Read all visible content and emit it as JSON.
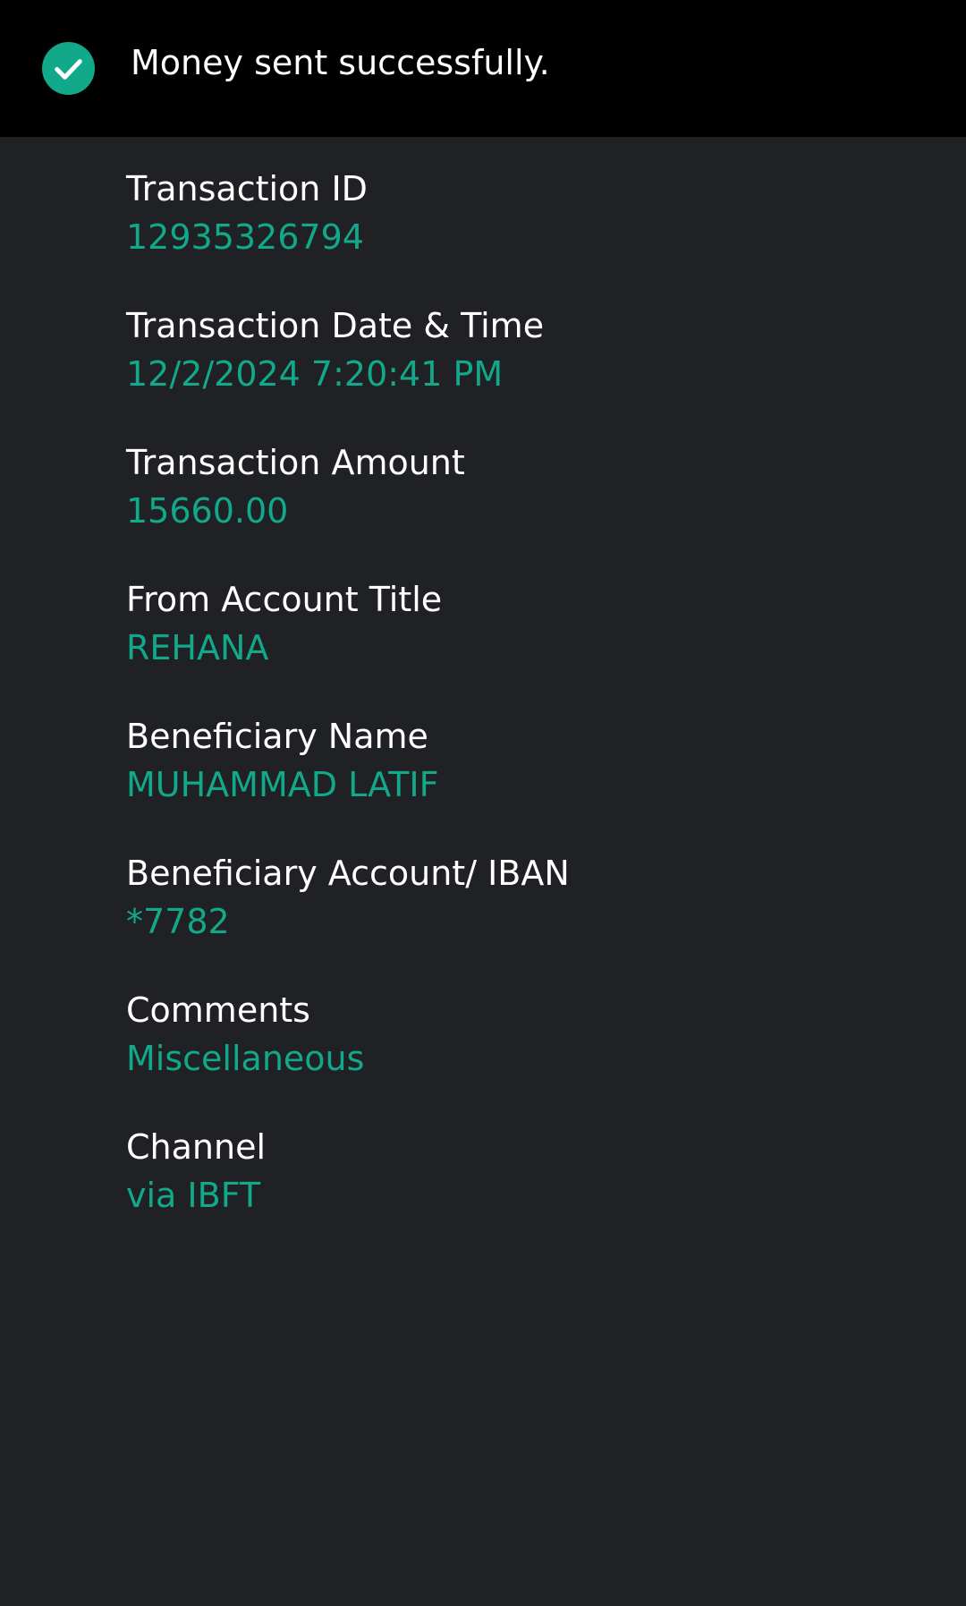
{
  "banner": {
    "message": "Money sent successfully.",
    "icon": "check-circle-icon",
    "accent_color": "#12a88a"
  },
  "details": [
    {
      "label": "Transaction ID",
      "value": "12935326794"
    },
    {
      "label": "Transaction Date & Time",
      "value": "12/2/2024 7:20:41 PM"
    },
    {
      "label": "Transaction Amount",
      "value": "15660.00"
    },
    {
      "label": "From Account Title",
      "value": "REHANA"
    },
    {
      "label": "Beneficiary Name",
      "value": "MUHAMMAD LATIF"
    },
    {
      "label": "Beneficiary Account/ IBAN",
      "value": "*7782"
    },
    {
      "label": "Comments",
      "value": "Miscellaneous"
    },
    {
      "label": "Channel",
      "value": "via IBFT"
    }
  ]
}
